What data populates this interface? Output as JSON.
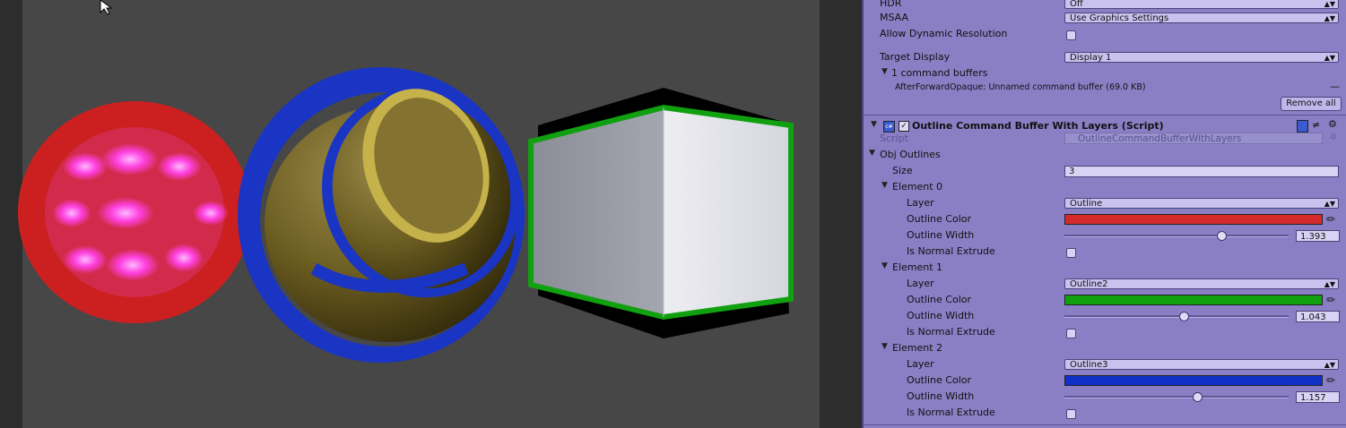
{
  "camera": {
    "hdr": {
      "label": "HDR",
      "value": "Off"
    },
    "msaa": {
      "label": "MSAA",
      "value": "Use Graphics Settings"
    },
    "dynamic_resolution": {
      "label": "Allow Dynamic Resolution",
      "checked": false
    },
    "target_display": {
      "label": "Target Display",
      "value": "Display 1"
    },
    "command_buffers": {
      "label": "1 command buffers",
      "entry": "AfterForwardOpaque: Unnamed command buffer (69.0 KB)",
      "remove_all": "Remove all"
    }
  },
  "component": {
    "title": "Outline Command Buffer With Layers (Script)",
    "script_label": "Script",
    "script_value": "OutlineCommandBufferWithLayers",
    "list_label": "Obj Outlines",
    "size_label": "Size",
    "size_value": "3",
    "elements": [
      {
        "name": "Element 0",
        "layer": "Outline",
        "color": "#d42a2a",
        "width": "1.393",
        "width_frac": 0.7,
        "extrude": false
      },
      {
        "name": "Element 1",
        "layer": "Outline2",
        "color": "#10a010",
        "width": "1.043",
        "width_frac": 0.53,
        "extrude": false
      },
      {
        "name": "Element 2",
        "layer": "Outline3",
        "color": "#1030c8",
        "width": "1.157",
        "width_frac": 0.59,
        "extrude": false
      }
    ],
    "field_labels": {
      "layer": "Layer",
      "color": "Outline Color",
      "width": "Outline Width",
      "extrude": "Is Normal Extrude"
    }
  },
  "colors": {
    "inspector_bg": "#8a7fc4",
    "scene_bg": "#474747"
  }
}
